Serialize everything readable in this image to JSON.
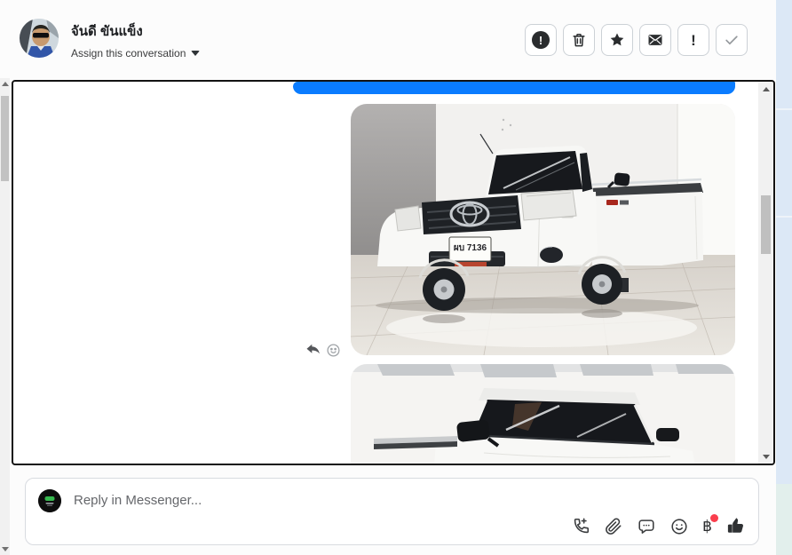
{
  "header": {
    "contact_name": "จันดี ขันแข็ง",
    "assign_label": "Assign this conversation",
    "actions": [
      {
        "id": "report",
        "icon": "exclamation-circle-icon"
      },
      {
        "id": "delete",
        "icon": "trash-icon"
      },
      {
        "id": "follow-up",
        "icon": "star-icon"
      },
      {
        "id": "mark-as-unread",
        "icon": "envelope-icon"
      },
      {
        "id": "mark-as-spam",
        "icon": "exclamation-icon"
      },
      {
        "id": "mark-as-done",
        "icon": "check-icon"
      }
    ]
  },
  "glyphs": {
    "exclamation": "!",
    "baht": "฿"
  },
  "chat": {
    "bubble_color": "#0a7cff",
    "photos": [
      {
        "description": "White Toyota Hilux single-cab pickup truck parked in a white showroom",
        "license_plate": "ผบ 7136"
      },
      {
        "description": "Close-up front view of the white pickup truck windshield and mirrors"
      }
    ],
    "hover_actions": [
      "reply",
      "react"
    ]
  },
  "composer": {
    "placeholder": "Reply in Messenger...",
    "has_payment_badge": true
  },
  "colors": {
    "bubble_blue": "#0a7cff",
    "right_band_top": "#dce8f6",
    "right_band_bottom": "#e2efec",
    "scrollbar_track": "#f1f1f1",
    "scrollbar_thumb": "#c2c2c2",
    "container_border": "#131313"
  }
}
